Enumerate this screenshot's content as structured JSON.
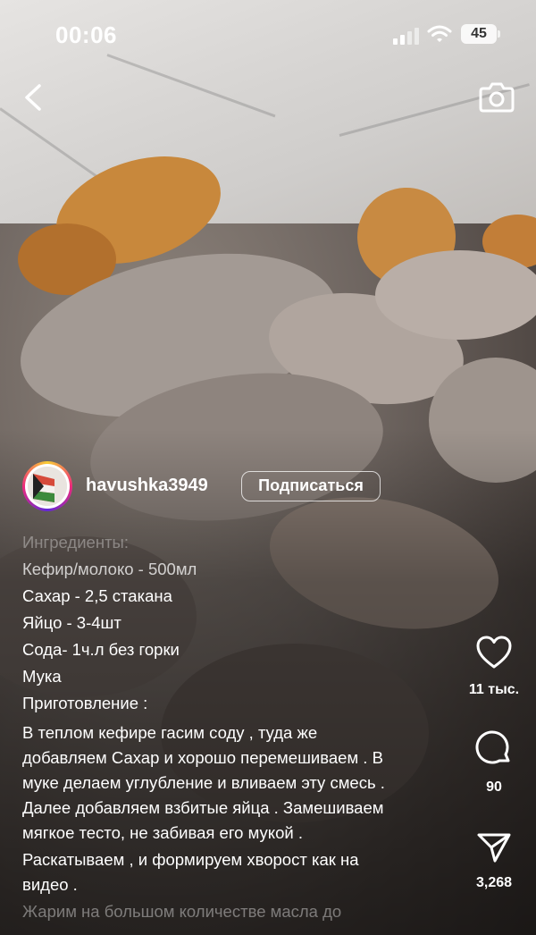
{
  "status_bar": {
    "time": "00:06",
    "battery": "45"
  },
  "post": {
    "username": "havushka3949",
    "follow_label": "Подписаться",
    "caption_lines": [
      "Ингредиенты:",
      "Кефир/молоко - 500мл",
      "Сахар - 2,5 стакана",
      "Яйцо - 3-4шт",
      "Сода- 1ч.л без горки",
      "Мука",
      "Приготовление :"
    ],
    "description_lines": [
      "В теплом кефире гасим соду , туда же",
      "добавляем Сахар и хорошо перемешиваем . В",
      "муке делаем углубление и вливаем эту смесь .",
      "Далее добавляем взбитые яйца . Замешиваем",
      "мягкое тесто, не забивая его мукой .",
      "Раскатываем , и формируем хворост как на",
      "видео .",
      "Жарим на большом количестве масла до"
    ]
  },
  "actions": {
    "likes": "11 тыс.",
    "comments": "90",
    "shares": "3,268"
  },
  "icons": [
    "back-arrow-icon",
    "camera-icon",
    "heart-icon",
    "comment-icon",
    "send-icon"
  ]
}
